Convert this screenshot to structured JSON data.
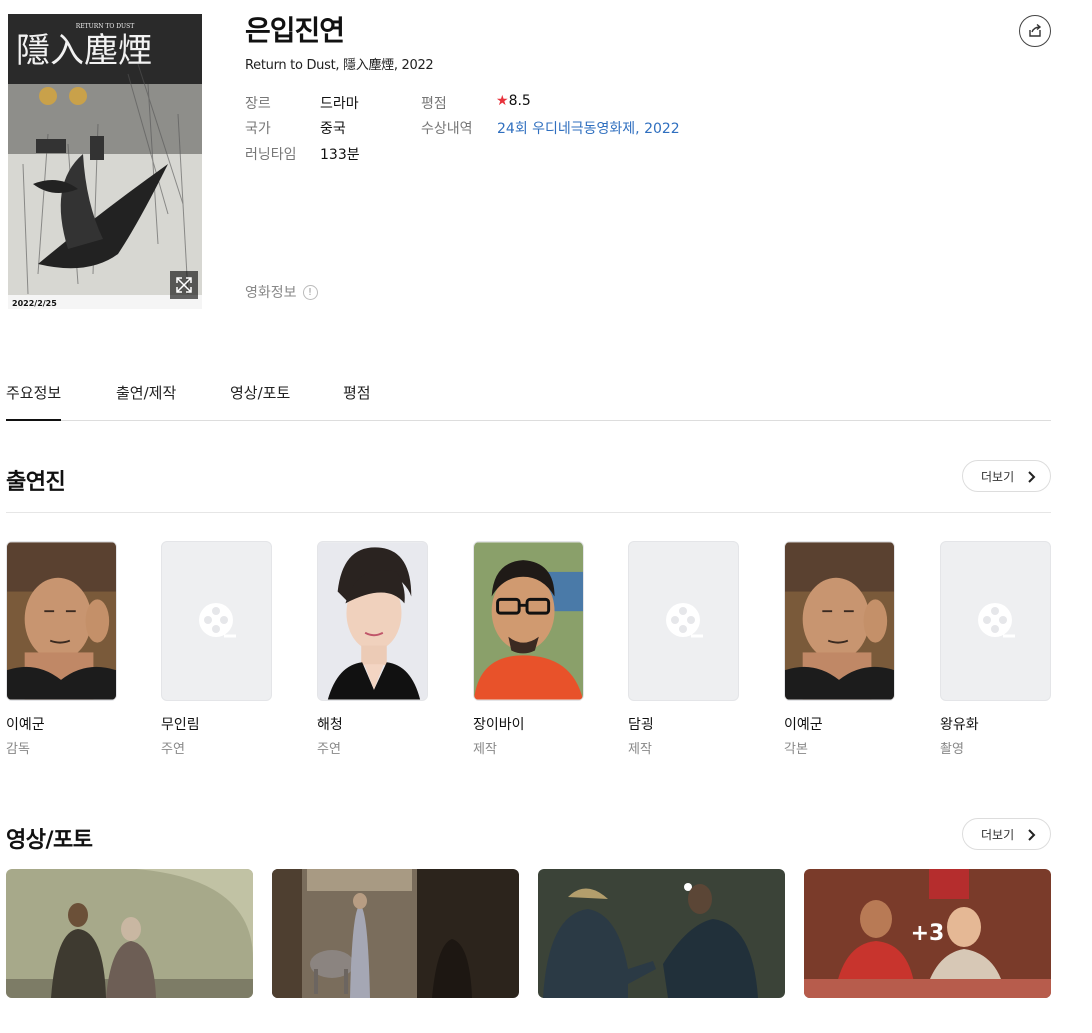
{
  "movie": {
    "title": "은입진연",
    "subtitle": "Return to Dust, 隱入塵煙, 2022",
    "poster_date": "2022/2/25",
    "poster_tagline": "RETURN TO DUST"
  },
  "info": {
    "genre_label": "장르",
    "genre_value": "드라마",
    "country_label": "국가",
    "country_value": "중국",
    "runtime_label": "러닝타임",
    "runtime_value": "133분",
    "rating_label": "평점",
    "rating_star": "★",
    "rating_value": "8.5",
    "award_label": "수상내역",
    "award_value": "24회 우디네극동영화제, 2022"
  },
  "movie_info_label": "영화정보",
  "info_icon_glyph": "!",
  "tabs": [
    {
      "label": "주요정보",
      "active": true
    },
    {
      "label": "출연/제작",
      "active": false
    },
    {
      "label": "영상/포토",
      "active": false
    },
    {
      "label": "평점",
      "active": false
    }
  ],
  "cast_section": {
    "title": "출연진",
    "more_label": "더보기",
    "members": [
      {
        "name": "이예군",
        "role": "감독",
        "photo": "director-portrait"
      },
      {
        "name": "무인림",
        "role": "주연",
        "photo": "placeholder-film-icon"
      },
      {
        "name": "해청",
        "role": "주연",
        "photo": "actress-portrait"
      },
      {
        "name": "장이바이",
        "role": "제작",
        "photo": "producer-portrait"
      },
      {
        "name": "담굉",
        "role": "제작",
        "photo": "placeholder-film-icon"
      },
      {
        "name": "이예군",
        "role": "각본",
        "photo": "director-portrait"
      },
      {
        "name": "왕유화",
        "role": "촬영",
        "photo": "placeholder-film-icon"
      }
    ]
  },
  "media_section": {
    "title": "영상/포토",
    "more_label": "더보기",
    "extra_count": "+3"
  },
  "colors": {
    "link": "#2f6fbf",
    "star": "#e8323c",
    "placeholder_bg": "#eeeff1"
  }
}
